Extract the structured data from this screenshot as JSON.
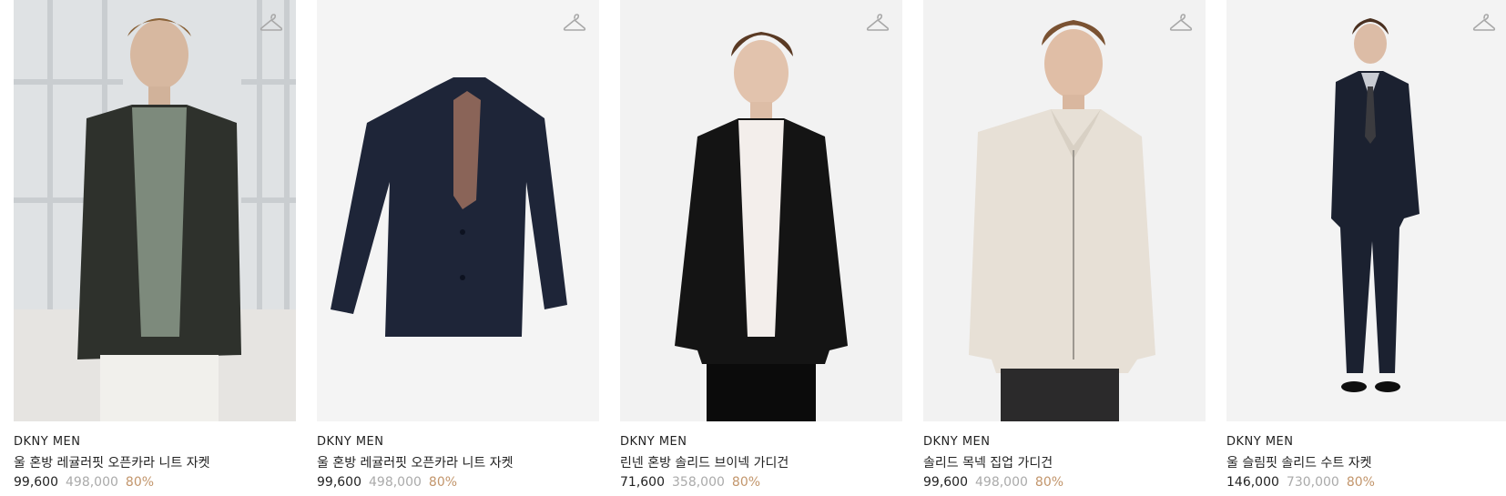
{
  "colors": {
    "accent_discount": "#c2956b",
    "original_price": "#aaaaaa",
    "image_bg": "#f3f3f3"
  },
  "products": [
    {
      "brand": "DKNY MEN",
      "name": "울 혼방 레귤러핏 오픈카라 니트 자켓",
      "price": "99,600",
      "original_price": "498,000",
      "discount": "80%",
      "wishlist_icon": "hanger-icon",
      "image_desc": "model"
    },
    {
      "brand": "DKNY MEN",
      "name": "울 혼방 레귤러핏 오픈카라 니트 자켓",
      "price": "99,600",
      "original_price": "498,000",
      "discount": "80%",
      "wishlist_icon": "hanger-icon",
      "image_desc": "flatlay"
    },
    {
      "brand": "DKNY MEN",
      "name": "린넨 혼방 솔리드 브이넥 가디건",
      "price": "71,600",
      "original_price": "358,000",
      "discount": "80%",
      "wishlist_icon": "hanger-icon",
      "image_desc": "model"
    },
    {
      "brand": "DKNY MEN",
      "name": "솔리드 목넥 집업 가디건",
      "price": "99,600",
      "original_price": "498,000",
      "discount": "80%",
      "wishlist_icon": "hanger-icon",
      "image_desc": "model"
    },
    {
      "brand": "DKNY MEN",
      "name": "울 슬림핏 솔리드 수트 자켓",
      "price": "146,000",
      "original_price": "730,000",
      "discount": "80%",
      "wishlist_icon": "hanger-icon",
      "image_desc": "model"
    }
  ]
}
